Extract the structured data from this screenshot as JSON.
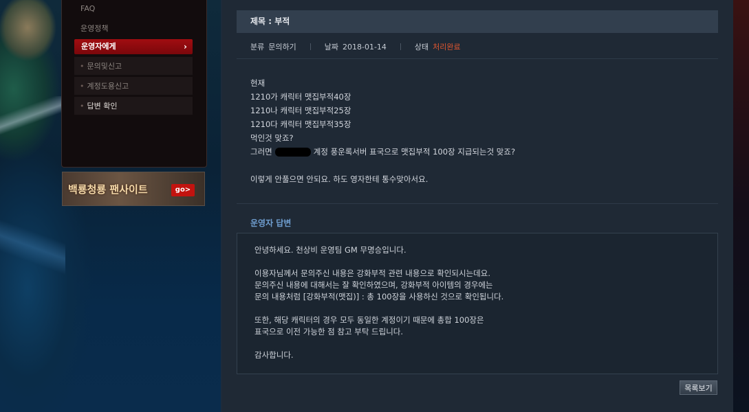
{
  "sidebar": {
    "items": [
      {
        "label": "FAQ"
      },
      {
        "label": "운영정책"
      },
      {
        "label": "운영자에게"
      },
      {
        "label": "문의및신고"
      },
      {
        "label": "계정도용신고"
      },
      {
        "label": "답변 확인"
      }
    ],
    "active_chevron": "›",
    "bullet": "•"
  },
  "banner": {
    "label": "백룡청룡 팬사이트",
    "go_label": "go>"
  },
  "post": {
    "title": "제목 : 부적",
    "category_label": "분류",
    "category_value": "문의하기",
    "date_label": "날짜",
    "date_value": "2018-01-14",
    "status_label": "상태",
    "status_value": "처리완료",
    "status_color": "#e0562f",
    "body_lines": [
      "현재",
      "1210가 캐릭터 맷집부적40장",
      "1210나 캐릭터 맷집부적25장",
      "1210다 캐릭터 맷집부적35장",
      "먹인것 맞죠?"
    ],
    "body_line6_pre": "그러면",
    "body_line6_post": "계정 풍운록서버 표국으로 맷집부적 100장 지급되는것 맞죠?",
    "body_last": "이렇게 안풀으면 안되요. 하도 영자한테 통수맞아서요."
  },
  "answer": {
    "title": "운영자 답변",
    "greeting": "안녕하세요. 천상비 운영팀 GM 무명승입니다.",
    "para1": [
      "이용자님께서 문의주신 내용은 강화부적 관련 내용으로 확인되시는데요.",
      "문의주신 내용에 대해서는 잘 확인하였으며, 강화부적 아이템의 경우에는",
      "문의 내용처럼 [강화부적(맷집)] : 총 100장을 사용하신 것으로 확인됩니다."
    ],
    "para2": [
      "또한, 해당 캐릭터의 경우 모두 동일한 계정이기 때문에 총합 100장은",
      "표국으로 이전 가능한 점 참고 부탁 드립니다."
    ],
    "closing": "감사합니다."
  },
  "buttons": {
    "list_label": "목록보기"
  },
  "colors": {
    "accent_red": "#a10d11",
    "answer_title": "#6f9ed0"
  }
}
